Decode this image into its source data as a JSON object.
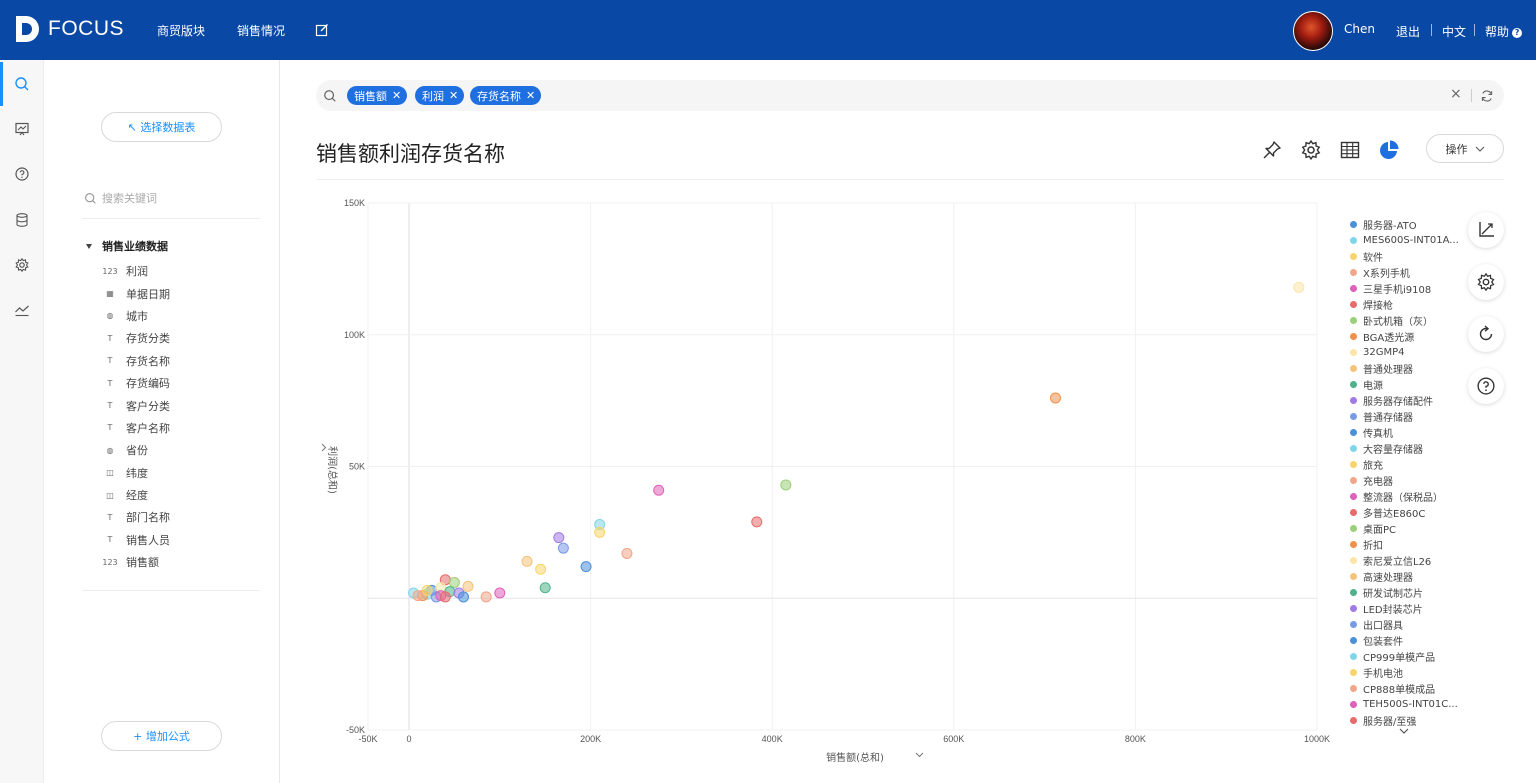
{
  "app": {
    "logo_text": "FOCUS"
  },
  "nav": {
    "items": [
      "商贸版块",
      "销售情况"
    ]
  },
  "user": {
    "name": "Chen",
    "logout": "退出",
    "language": "中文",
    "help": "帮助",
    "help_badge": "?"
  },
  "rail": {
    "icons": [
      "search-icon",
      "dashboard-icon",
      "help-icon",
      "database-icon",
      "settings-icon",
      "trend-icon"
    ]
  },
  "panel": {
    "select_table": "↖ 选择数据表",
    "search_placeholder": "搜索关键词",
    "tree_root": "销售业绩数据",
    "fields": [
      {
        "label": "利润",
        "icon": "number-icon"
      },
      {
        "label": "单据日期",
        "icon": "calendar-icon"
      },
      {
        "label": "城市",
        "icon": "globe-icon"
      },
      {
        "label": "存货分类",
        "icon": "text-icon"
      },
      {
        "label": "存货名称",
        "icon": "text-icon"
      },
      {
        "label": "存货编码",
        "icon": "text-icon"
      },
      {
        "label": "客户分类",
        "icon": "text-icon"
      },
      {
        "label": "客户名称",
        "icon": "text-icon"
      },
      {
        "label": "省份",
        "icon": "globe-icon"
      },
      {
        "label": "纬度",
        "icon": "map-icon"
      },
      {
        "label": "经度",
        "icon": "map-icon"
      },
      {
        "label": "部门名称",
        "icon": "text-icon"
      },
      {
        "label": "销售人员",
        "icon": "text-icon"
      },
      {
        "label": "销售额",
        "icon": "number-icon"
      }
    ],
    "add_formula": "+ 增加公式"
  },
  "search": {
    "tags": [
      "销售额",
      "利润",
      "存货名称"
    ],
    "clear": "×"
  },
  "main": {
    "title": "销售额利润存货名称",
    "operate": "操作"
  },
  "chart_data": {
    "type": "scatter",
    "xlabel": "销售额(总和)",
    "ylabel": "利润(总和)",
    "xlim": [
      -50000,
      1000000
    ],
    "ylim": [
      -50000,
      150000
    ],
    "x_ticks": [
      "-50K",
      "0",
      "200K",
      "400K",
      "600K",
      "800K",
      "1000K"
    ],
    "y_ticks": [
      "-50K",
      "50K",
      "100K",
      "150K"
    ],
    "series": [
      {
        "name": "服务器-ATO",
        "color": "#4a90d9",
        "x": 195000,
        "y": 12000
      },
      {
        "name": "MES600S-INT01A...",
        "color": "#7fd6e6",
        "x": 210000,
        "y": 28000
      },
      {
        "name": "软件",
        "color": "#f7d56a",
        "x": 210000,
        "y": 25000
      },
      {
        "name": "X系列手机",
        "color": "#f2a58a",
        "x": 240000,
        "y": 17000
      },
      {
        "name": "三星手机i9108",
        "color": "#e060b8",
        "x": 275000,
        "y": 41000
      },
      {
        "name": "焊接枪",
        "color": "#e86b6b",
        "x": 383000,
        "y": 29000
      },
      {
        "name": "卧式机箱（灰）",
        "color": "#9ccf7a",
        "x": 415000,
        "y": 43000
      },
      {
        "name": "BGA透光源",
        "color": "#f0904a",
        "x": 712000,
        "y": 76000
      },
      {
        "name": "32GMP4",
        "color": "#fbe6a8",
        "x": 980000,
        "y": 118000
      },
      {
        "name": "普通处理器",
        "color": "#f5c27a",
        "x": 130000,
        "y": 14000
      },
      {
        "name": "电源",
        "color": "#4fb38a",
        "x": 150000,
        "y": 4000
      },
      {
        "name": "服务器存储配件",
        "color": "#a07ae6",
        "x": 165000,
        "y": 23000
      },
      {
        "name": "普通存储器",
        "color": "#7a9ae8",
        "x": 170000,
        "y": 19000
      },
      {
        "name": "传真机",
        "color": "#4a90d9",
        "x": 25000,
        "y": 3000
      },
      {
        "name": "大容量存储器",
        "color": "#7fd6e6",
        "x": 20000,
        "y": 1500
      },
      {
        "name": "旅充",
        "color": "#f7d56a",
        "x": 145000,
        "y": 11000
      },
      {
        "name": "充电器",
        "color": "#f2a58a",
        "x": 85000,
        "y": 500
      },
      {
        "name": "整流器（保税品）",
        "color": "#e060b8",
        "x": 100000,
        "y": 2000
      },
      {
        "name": "多普达E860C",
        "color": "#e86b6b",
        "x": 40000,
        "y": 7000
      },
      {
        "name": "桌面PC",
        "color": "#9ccf7a",
        "x": 50000,
        "y": 6000
      },
      {
        "name": "折扣",
        "color": "#f0904a",
        "x": 15000,
        "y": 1000
      },
      {
        "name": "索尼爱立信L26",
        "color": "#fbe6a8",
        "x": 35000,
        "y": 4000
      },
      {
        "name": "高速处理器",
        "color": "#f5c27a",
        "x": 65000,
        "y": 4500
      },
      {
        "name": "研发试制芯片",
        "color": "#4fb38a",
        "x": 45000,
        "y": 2500
      },
      {
        "name": "LED封装芯片",
        "color": "#a07ae6",
        "x": 55000,
        "y": 2000
      },
      {
        "name": "出口器具",
        "color": "#7a9ae8",
        "x": 30000,
        "y": 500
      },
      {
        "name": "包装套件",
        "color": "#4a90d9",
        "x": 60000,
        "y": 500
      },
      {
        "name": "CP999单模产品",
        "color": "#7fd6e6",
        "x": 5000,
        "y": 2000
      },
      {
        "name": "手机电池",
        "color": "#f7d56a",
        "x": 20000,
        "y": 3000
      },
      {
        "name": "CP888单模成品",
        "color": "#f2a58a",
        "x": 10000,
        "y": 1000
      },
      {
        "name": "TEH500S-INT01C...",
        "color": "#e060b8",
        "x": 35000,
        "y": 1000
      },
      {
        "name": "服务器/至强",
        "color": "#e86b6b",
        "x": 40000,
        "y": 500
      }
    ]
  }
}
